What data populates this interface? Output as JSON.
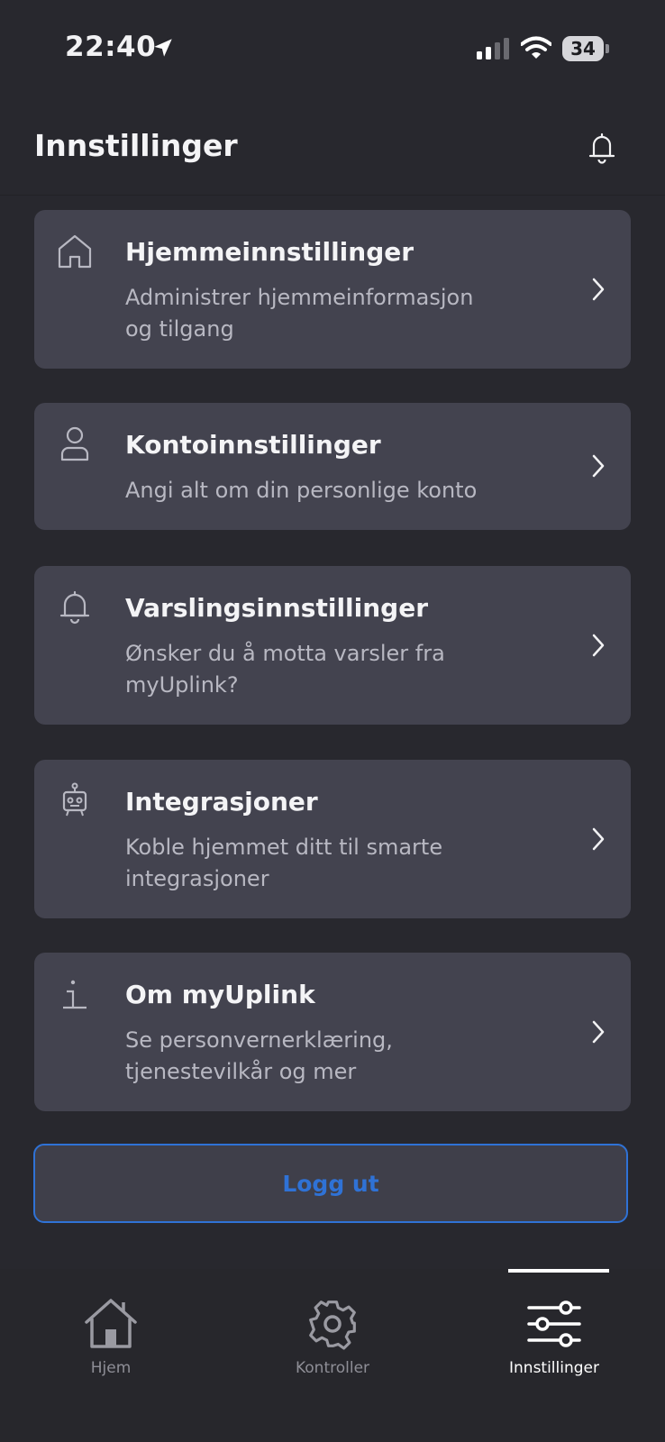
{
  "status": {
    "time": "22:40",
    "battery": "34"
  },
  "header": {
    "title": "Innstillinger"
  },
  "settings": [
    {
      "title": "Hjemmeinnstillinger",
      "desc": "Administrer hjemmeinformasjon og tilgang",
      "icon": "home-icon"
    },
    {
      "title": "Kontoinnstillinger",
      "desc": "Angi alt om din personlige konto",
      "icon": "user-icon"
    },
    {
      "title": "Varslingsinnstillinger",
      "desc": "Ønsker du å motta varsler fra myUplink?",
      "icon": "bell-icon"
    },
    {
      "title": "Integrasjoner",
      "desc": "Koble hjemmet ditt til smarte integrasjoner",
      "icon": "robot-icon"
    },
    {
      "title": "Om myUplink",
      "desc": "Se personvernerklæring, tjenestevilkår og mer",
      "icon": "info-icon"
    }
  ],
  "logout": {
    "label": "Logg ut"
  },
  "tabs": [
    {
      "label": "Hjem",
      "icon": "house-icon"
    },
    {
      "label": "Kontroller",
      "icon": "gear-icon"
    },
    {
      "label": "Innstillinger",
      "icon": "sliders-icon",
      "active": true
    }
  ],
  "colors": {
    "background": "#28282e",
    "card": "#43434f",
    "accent": "#2f72d6"
  }
}
